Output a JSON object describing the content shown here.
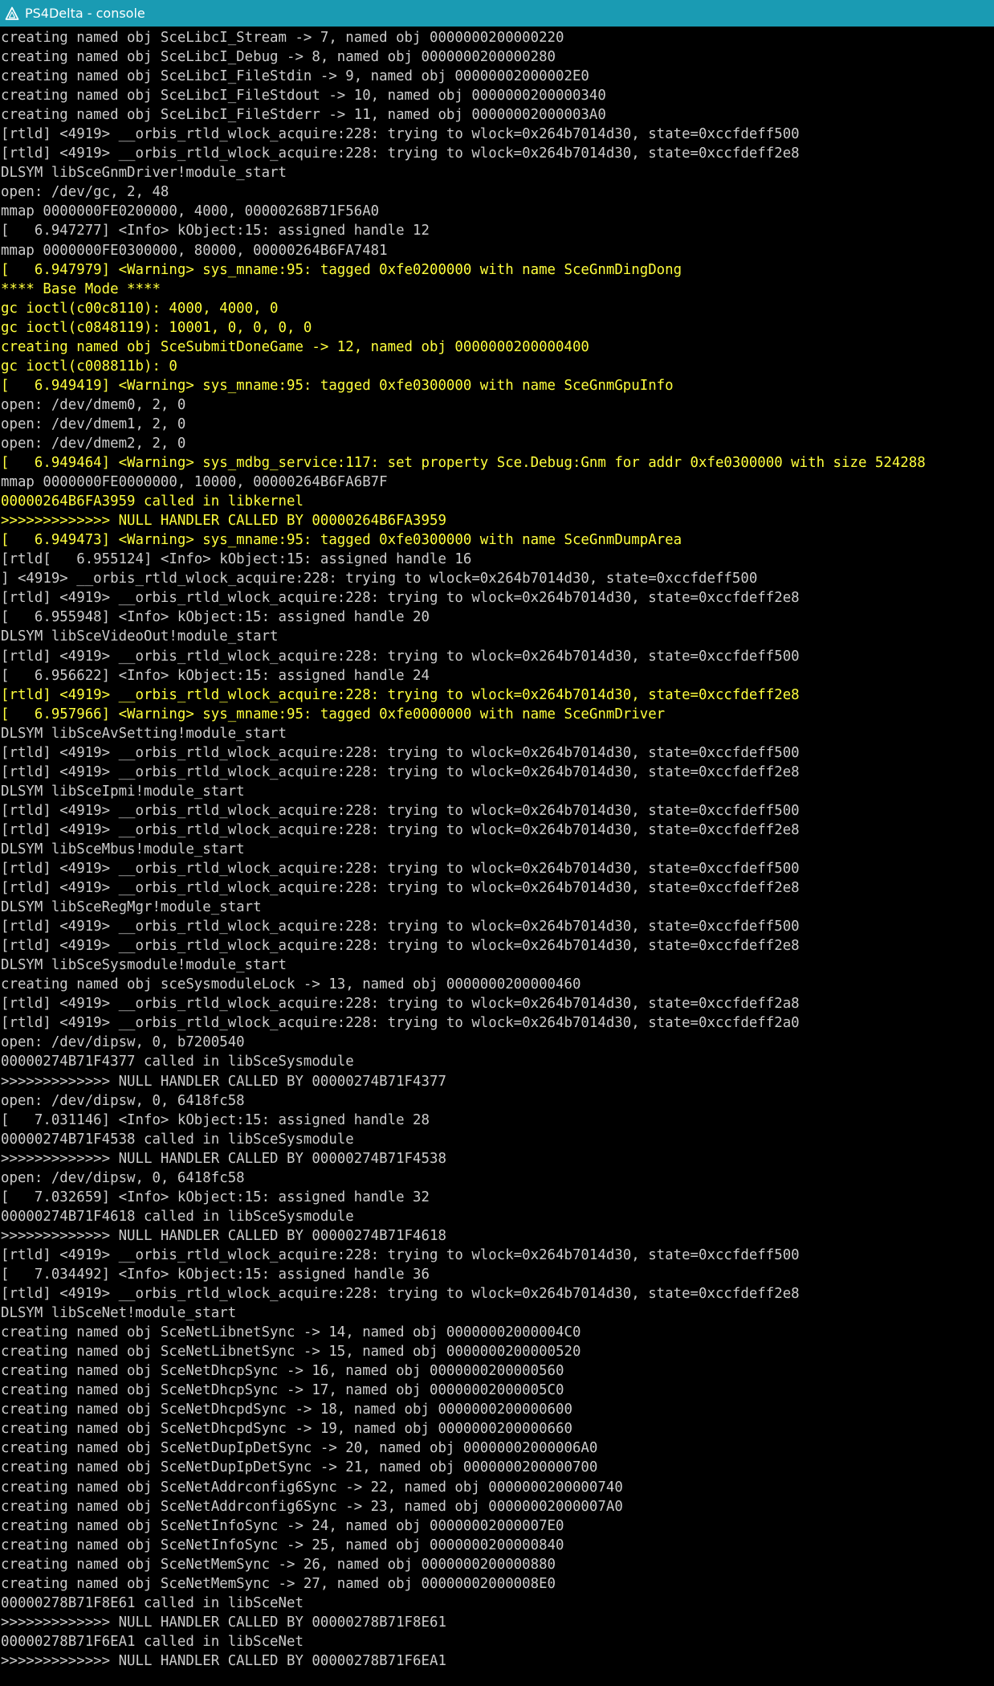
{
  "window": {
    "title": "PS4Delta - console",
    "icon": "ps4delta-triangle-icon",
    "titlebar_color": "#1a9bb3"
  },
  "colors": {
    "default_text": "#cccccc",
    "highlight_text": "#ffff3c",
    "background": "#000000"
  },
  "console": {
    "lines": [
      {
        "text": "creating named obj SceLibcI_Stream -> 7, named obj 0000000200000220",
        "color": "default"
      },
      {
        "text": "creating named obj SceLibcI_Debug -> 8, named obj 0000000200000280",
        "color": "default"
      },
      {
        "text": "creating named obj SceLibcI_FileStdin -> 9, named obj 00000002000002E0",
        "color": "default"
      },
      {
        "text": "creating named obj SceLibcI_FileStdout -> 10, named obj 0000000200000340",
        "color": "default"
      },
      {
        "text": "creating named obj SceLibcI_FileStderr -> 11, named obj 00000002000003A0",
        "color": "default"
      },
      {
        "text": "[rtld] <4919> __orbis_rtld_wlock_acquire:228: trying to wlock=0x264b7014d30, state=0xccfdeff500",
        "color": "default"
      },
      {
        "text": "[rtld] <4919> __orbis_rtld_wlock_acquire:228: trying to wlock=0x264b7014d30, state=0xccfdeff2e8",
        "color": "default"
      },
      {
        "text": "DLSYM libSceGnmDriver!module_start",
        "color": "default"
      },
      {
        "text": "open: /dev/gc, 2, 48",
        "color": "default"
      },
      {
        "text": "mmap 0000000FE0200000, 4000, 00000268B71F56A0",
        "color": "default"
      },
      {
        "text": "[   6.947277] <Info> kObject:15: assigned handle 12",
        "color": "default"
      },
      {
        "text": "mmap 0000000FE0300000, 80000, 00000264B6FA7481",
        "color": "default"
      },
      {
        "text": "[   6.947979] <Warning> sys_mname:95: tagged 0xfe0200000 with name SceGnmDingDong",
        "color": "yellow"
      },
      {
        "text": "**** Base Mode ****",
        "color": "yellow"
      },
      {
        "text": "gc ioctl(c00c8110): 4000, 4000, 0",
        "color": "yellow"
      },
      {
        "text": "gc ioctl(c0848119): 10001, 0, 0, 0, 0",
        "color": "yellow"
      },
      {
        "text": "creating named obj SceSubmitDoneGame -> 12, named obj 0000000200000400",
        "color": "yellow"
      },
      {
        "text": "gc ioctl(c008811b): 0",
        "color": "yellow"
      },
      {
        "text": "[   6.949419] <Warning> sys_mname:95: tagged 0xfe0300000 with name SceGnmGpuInfo",
        "color": "yellow"
      },
      {
        "text": "open: /dev/dmem0, 2, 0",
        "color": "default"
      },
      {
        "text": "open: /dev/dmem1, 2, 0",
        "color": "default"
      },
      {
        "text": "open: /dev/dmem2, 2, 0",
        "color": "default"
      },
      {
        "text": "[   6.949464] <Warning> sys_mdbg_service:117: set property Sce.Debug:Gnm for addr 0xfe0300000 with size 524288",
        "color": "yellow"
      },
      {
        "text": "mmap 0000000FE0000000, 10000, 00000264B6FA6B7F",
        "color": "default"
      },
      {
        "text": "00000264B6FA3959 called in libkernel",
        "color": "yellow"
      },
      {
        "text": ">>>>>>>>>>>>> NULL HANDLER CALLED BY 00000264B6FA3959",
        "color": "yellow"
      },
      {
        "text": "[   6.949473] <Warning> sys_mname:95: tagged 0xfe0300000 with name SceGnmDumpArea",
        "color": "yellow"
      },
      {
        "text": "[rtld[   6.955124] <Info> kObject:15: assigned handle 16",
        "color": "default"
      },
      {
        "text": "] <4919> __orbis_rtld_wlock_acquire:228: trying to wlock=0x264b7014d30, state=0xccfdeff500",
        "color": "default"
      },
      {
        "text": "[rtld] <4919> __orbis_rtld_wlock_acquire:228: trying to wlock=0x264b7014d30, state=0xccfdeff2e8",
        "color": "default"
      },
      {
        "text": "[   6.955948] <Info> kObject:15: assigned handle 20",
        "color": "default"
      },
      {
        "text": "DLSYM libSceVideoOut!module_start",
        "color": "default"
      },
      {
        "text": "[rtld] <4919> __orbis_rtld_wlock_acquire:228: trying to wlock=0x264b7014d30, state=0xccfdeff500",
        "color": "default"
      },
      {
        "text": "[   6.956622] <Info> kObject:15: assigned handle 24",
        "color": "default"
      },
      {
        "text": "[rtld] <4919> __orbis_rtld_wlock_acquire:228: trying to wlock=0x264b7014d30, state=0xccfdeff2e8",
        "color": "yellow"
      },
      {
        "text": "[   6.957966] <Warning> sys_mname:95: tagged 0xfe0000000 with name SceGnmDriver",
        "color": "yellow"
      },
      {
        "text": "DLSYM libSceAvSetting!module_start",
        "color": "default"
      },
      {
        "text": "[rtld] <4919> __orbis_rtld_wlock_acquire:228: trying to wlock=0x264b7014d30, state=0xccfdeff500",
        "color": "default"
      },
      {
        "text": "[rtld] <4919> __orbis_rtld_wlock_acquire:228: trying to wlock=0x264b7014d30, state=0xccfdeff2e8",
        "color": "default"
      },
      {
        "text": "DLSYM libSceIpmi!module_start",
        "color": "default"
      },
      {
        "text": "[rtld] <4919> __orbis_rtld_wlock_acquire:228: trying to wlock=0x264b7014d30, state=0xccfdeff500",
        "color": "default"
      },
      {
        "text": "[rtld] <4919> __orbis_rtld_wlock_acquire:228: trying to wlock=0x264b7014d30, state=0xccfdeff2e8",
        "color": "default"
      },
      {
        "text": "DLSYM libSceMbus!module_start",
        "color": "default"
      },
      {
        "text": "[rtld] <4919> __orbis_rtld_wlock_acquire:228: trying to wlock=0x264b7014d30, state=0xccfdeff500",
        "color": "default"
      },
      {
        "text": "[rtld] <4919> __orbis_rtld_wlock_acquire:228: trying to wlock=0x264b7014d30, state=0xccfdeff2e8",
        "color": "default"
      },
      {
        "text": "DLSYM libSceRegMgr!module_start",
        "color": "default"
      },
      {
        "text": "[rtld] <4919> __orbis_rtld_wlock_acquire:228: trying to wlock=0x264b7014d30, state=0xccfdeff500",
        "color": "default"
      },
      {
        "text": "[rtld] <4919> __orbis_rtld_wlock_acquire:228: trying to wlock=0x264b7014d30, state=0xccfdeff2e8",
        "color": "default"
      },
      {
        "text": "DLSYM libSceSysmodule!module_start",
        "color": "default"
      },
      {
        "text": "creating named obj sceSysmoduleLock -> 13, named obj 0000000200000460",
        "color": "default"
      },
      {
        "text": "[rtld] <4919> __orbis_rtld_wlock_acquire:228: trying to wlock=0x264b7014d30, state=0xccfdeff2a8",
        "color": "default"
      },
      {
        "text": "[rtld] <4919> __orbis_rtld_wlock_acquire:228: trying to wlock=0x264b7014d30, state=0xccfdeff2a0",
        "color": "default"
      },
      {
        "text": "open: /dev/dipsw, 0, b7200540",
        "color": "default"
      },
      {
        "text": "00000274B71F4377 called in libSceSysmodule",
        "color": "default"
      },
      {
        "text": ">>>>>>>>>>>>> NULL HANDLER CALLED BY 00000274B71F4377",
        "color": "default"
      },
      {
        "text": "open: /dev/dipsw, 0, 6418fc58",
        "color": "default"
      },
      {
        "text": "[   7.031146] <Info> kObject:15: assigned handle 28",
        "color": "default"
      },
      {
        "text": "00000274B71F4538 called in libSceSysmodule",
        "color": "default"
      },
      {
        "text": ">>>>>>>>>>>>> NULL HANDLER CALLED BY 00000274B71F4538",
        "color": "default"
      },
      {
        "text": "open: /dev/dipsw, 0, 6418fc58",
        "color": "default"
      },
      {
        "text": "[   7.032659] <Info> kObject:15: assigned handle 32",
        "color": "default"
      },
      {
        "text": "00000274B71F4618 called in libSceSysmodule",
        "color": "default"
      },
      {
        "text": ">>>>>>>>>>>>> NULL HANDLER CALLED BY 00000274B71F4618",
        "color": "default"
      },
      {
        "text": "[rtld] <4919> __orbis_rtld_wlock_acquire:228: trying to wlock=0x264b7014d30, state=0xccfdeff500",
        "color": "default"
      },
      {
        "text": "[   7.034492] <Info> kObject:15: assigned handle 36",
        "color": "default"
      },
      {
        "text": "[rtld] <4919> __orbis_rtld_wlock_acquire:228: trying to wlock=0x264b7014d30, state=0xccfdeff2e8",
        "color": "default"
      },
      {
        "text": "DLSYM libSceNet!module_start",
        "color": "default"
      },
      {
        "text": "creating named obj SceNetLibnetSync -> 14, named obj 00000002000004C0",
        "color": "default"
      },
      {
        "text": "creating named obj SceNetLibnetSync -> 15, named obj 0000000200000520",
        "color": "default"
      },
      {
        "text": "creating named obj SceNetDhcpSync -> 16, named obj 0000000200000560",
        "color": "default"
      },
      {
        "text": "creating named obj SceNetDhcpSync -> 17, named obj 00000002000005C0",
        "color": "default"
      },
      {
        "text": "creating named obj SceNetDhcpdSync -> 18, named obj 0000000200000600",
        "color": "default"
      },
      {
        "text": "creating named obj SceNetDhcpdSync -> 19, named obj 0000000200000660",
        "color": "default"
      },
      {
        "text": "creating named obj SceNetDupIpDetSync -> 20, named obj 00000002000006A0",
        "color": "default"
      },
      {
        "text": "creating named obj SceNetDupIpDetSync -> 21, named obj 0000000200000700",
        "color": "default"
      },
      {
        "text": "creating named obj SceNetAddrconfig6Sync -> 22, named obj 0000000200000740",
        "color": "default"
      },
      {
        "text": "creating named obj SceNetAddrconfig6Sync -> 23, named obj 00000002000007A0",
        "color": "default"
      },
      {
        "text": "creating named obj SceNetInfoSync -> 24, named obj 00000002000007E0",
        "color": "default"
      },
      {
        "text": "creating named obj SceNetInfoSync -> 25, named obj 0000000200000840",
        "color": "default"
      },
      {
        "text": "creating named obj SceNetMemSync -> 26, named obj 0000000200000880",
        "color": "default"
      },
      {
        "text": "creating named obj SceNetMemSync -> 27, named obj 00000002000008E0",
        "color": "default"
      },
      {
        "text": "00000278B71F8E61 called in libSceNet",
        "color": "default"
      },
      {
        "text": ">>>>>>>>>>>>> NULL HANDLER CALLED BY 00000278B71F8E61",
        "color": "default"
      },
      {
        "text": "00000278B71F6EA1 called in libSceNet",
        "color": "default"
      },
      {
        "text": ">>>>>>>>>>>>> NULL HANDLER CALLED BY 00000278B71F6EA1",
        "color": "default"
      }
    ]
  }
}
